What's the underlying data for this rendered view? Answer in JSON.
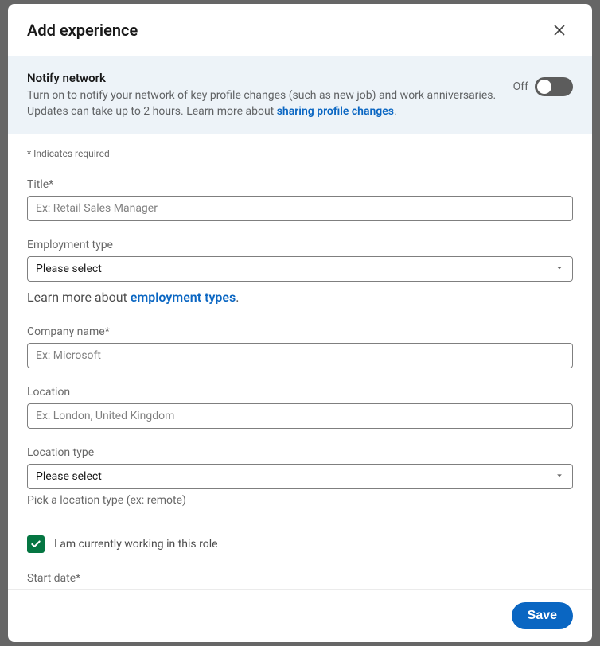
{
  "header": {
    "title": "Add experience"
  },
  "notify": {
    "title": "Notify network",
    "description_prefix": "Turn on to notify your network of key profile changes (such as new job) and work anniversaries. Updates can take up to 2 hours. Learn more about ",
    "link_text": "sharing profile changes",
    "description_suffix": ".",
    "toggle_label": "Off"
  },
  "form": {
    "required_hint": "* Indicates required",
    "title": {
      "label": "Title*",
      "placeholder": "Ex: Retail Sales Manager",
      "value": ""
    },
    "employment_type": {
      "label": "Employment type",
      "selected": "Please select",
      "learn_prefix": "Learn more about ",
      "learn_link": "employment types",
      "learn_suffix": "."
    },
    "company": {
      "label": "Company name*",
      "placeholder": "Ex: Microsoft",
      "value": ""
    },
    "location": {
      "label": "Location",
      "placeholder": "Ex: London, United Kingdom",
      "value": ""
    },
    "location_type": {
      "label": "Location type",
      "selected": "Please select",
      "help": "Pick a location type (ex: remote)"
    },
    "currently_working": {
      "label": "I am currently working in this role",
      "checked": true
    },
    "start_date": {
      "label": "Start date*"
    }
  },
  "footer": {
    "save_label": "Save"
  }
}
